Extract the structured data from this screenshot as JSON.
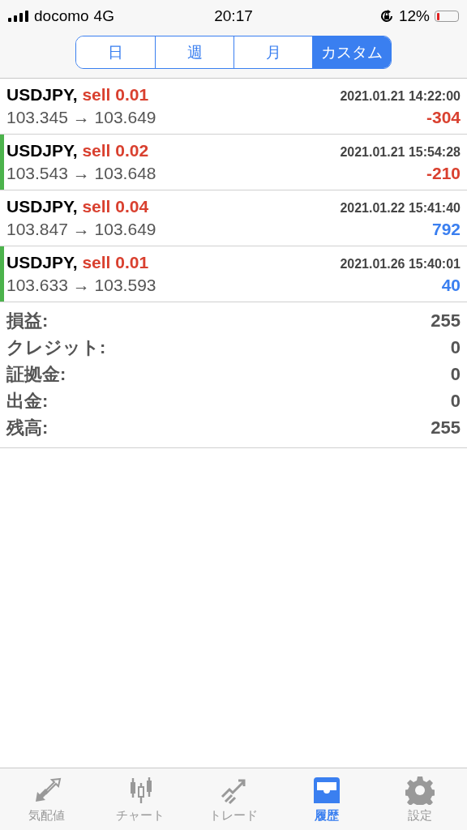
{
  "status_bar": {
    "carrier": "docomo",
    "network": "4G",
    "time": "20:17",
    "battery": "12%"
  },
  "tabs": [
    {
      "label": "日",
      "selected": false
    },
    {
      "label": "週",
      "selected": false
    },
    {
      "label": "月",
      "selected": false
    },
    {
      "label": "カスタム",
      "selected": true
    }
  ],
  "trades": [
    {
      "symbol": "USDJPY,",
      "order": "sell 0.01",
      "time": "2021.01.21 14:22:00",
      "prices": "103.345 → 103.649",
      "profit": "-304",
      "color": "#d9402f",
      "marked": false
    },
    {
      "symbol": "USDJPY,",
      "order": "sell 0.02",
      "time": "2021.01.21 15:54:28",
      "prices": "103.543 → 103.648",
      "profit": "-210",
      "color": "#d9402f",
      "marked": true
    },
    {
      "symbol": "USDJPY,",
      "order": "sell 0.04",
      "time": "2021.01.22 15:41:40",
      "prices": "103.847 → 103.649",
      "profit": "792",
      "color": "#3a7ff0",
      "marked": false
    },
    {
      "symbol": "USDJPY,",
      "order": "sell 0.01",
      "time": "2021.01.26 15:40:01",
      "prices": "103.633 → 103.593",
      "profit": "40",
      "color": "#3a7ff0",
      "marked": true
    }
  ],
  "summary": [
    {
      "label": "損益:",
      "value": "255"
    },
    {
      "label": "クレジット:",
      "value": "0"
    },
    {
      "label": "証拠金:",
      "value": "0"
    },
    {
      "label": "出金:",
      "value": "0"
    },
    {
      "label": "残高:",
      "value": "255"
    }
  ],
  "tab_bar": [
    {
      "label": "気配値",
      "kind": "quotes",
      "selected": false
    },
    {
      "label": "チャート",
      "kind": "chart",
      "selected": false
    },
    {
      "label": "トレード",
      "kind": "trade",
      "selected": false
    },
    {
      "label": "履歴",
      "kind": "history",
      "selected": true
    },
    {
      "label": "設定",
      "kind": "settings",
      "selected": false
    }
  ]
}
